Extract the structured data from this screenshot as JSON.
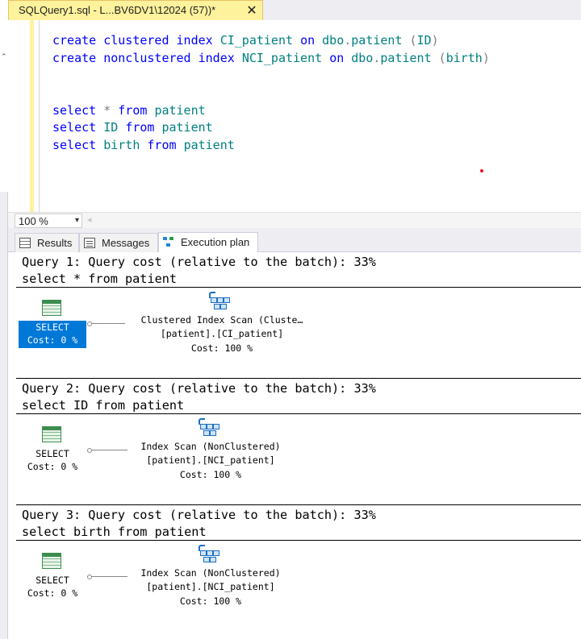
{
  "window": {
    "tab_title": "SQLQuery1.sql - L...BV6DV1\\12024 (57))*",
    "tab_close": "✕"
  },
  "editor": {
    "lines": [
      [
        {
          "t": "create",
          "c": "kw"
        },
        {
          "t": " ",
          "c": "txt"
        },
        {
          "t": "clustered",
          "c": "kw"
        },
        {
          "t": " ",
          "c": "txt"
        },
        {
          "t": "index",
          "c": "kw"
        },
        {
          "t": " ",
          "c": "txt"
        },
        {
          "t": "CI_patient",
          "c": "id"
        },
        {
          "t": " ",
          "c": "txt"
        },
        {
          "t": "on",
          "c": "kw"
        },
        {
          "t": " ",
          "c": "txt"
        },
        {
          "t": "dbo",
          "c": "id"
        },
        {
          "t": ".",
          "c": "op"
        },
        {
          "t": "patient",
          "c": "id"
        },
        {
          "t": " ",
          "c": "txt"
        },
        {
          "t": "(",
          "c": "op"
        },
        {
          "t": "ID",
          "c": "id"
        },
        {
          "t": ")",
          "c": "op"
        }
      ],
      [
        {
          "t": "create",
          "c": "kw"
        },
        {
          "t": " ",
          "c": "txt"
        },
        {
          "t": "nonclustered",
          "c": "kw"
        },
        {
          "t": " ",
          "c": "txt"
        },
        {
          "t": "index",
          "c": "kw"
        },
        {
          "t": " ",
          "c": "txt"
        },
        {
          "t": "NCI_patient",
          "c": "id"
        },
        {
          "t": " ",
          "c": "txt"
        },
        {
          "t": "on",
          "c": "kw"
        },
        {
          "t": " ",
          "c": "txt"
        },
        {
          "t": "dbo",
          "c": "id"
        },
        {
          "t": ".",
          "c": "op"
        },
        {
          "t": "patient",
          "c": "id"
        },
        {
          "t": " ",
          "c": "txt"
        },
        {
          "t": "(",
          "c": "op"
        },
        {
          "t": "birth",
          "c": "id"
        },
        {
          "t": ")",
          "c": "op"
        }
      ],
      [],
      [],
      [
        {
          "t": "select",
          "c": "kw"
        },
        {
          "t": " ",
          "c": "txt"
        },
        {
          "t": "*",
          "c": "op"
        },
        {
          "t": " ",
          "c": "txt"
        },
        {
          "t": "from",
          "c": "kw"
        },
        {
          "t": " ",
          "c": "txt"
        },
        {
          "t": "patient",
          "c": "id"
        }
      ],
      [
        {
          "t": "select",
          "c": "kw"
        },
        {
          "t": " ",
          "c": "txt"
        },
        {
          "t": "ID",
          "c": "id"
        },
        {
          "t": " ",
          "c": "txt"
        },
        {
          "t": "from",
          "c": "kw"
        },
        {
          "t": " ",
          "c": "txt"
        },
        {
          "t": "patient",
          "c": "id"
        }
      ],
      [
        {
          "t": "select",
          "c": "kw"
        },
        {
          "t": " ",
          "c": "txt"
        },
        {
          "t": "birth",
          "c": "id"
        },
        {
          "t": " ",
          "c": "txt"
        },
        {
          "t": "from",
          "c": "kw"
        },
        {
          "t": " ",
          "c": "txt"
        },
        {
          "t": "patient",
          "c": "id"
        }
      ]
    ]
  },
  "zoom": {
    "value": "100 %",
    "arrow": "▾",
    "scroll_left": "◂"
  },
  "result_tabs": [
    {
      "label": "Results",
      "icon": "grid-icon"
    },
    {
      "label": "Messages",
      "icon": "messages-icon"
    },
    {
      "label": "Execution plan",
      "icon": "execution-plan-icon",
      "active": true
    }
  ],
  "queries": [
    {
      "header": "Query 1: Query cost (relative to the batch): 33%",
      "sql": "select * from patient",
      "select_label": "SELECT",
      "select_cost": "Cost: 0 %",
      "selected": true,
      "op_line1": "Clustered Index Scan (Cluste…",
      "op_line2": "[patient].[CI_patient]",
      "op_cost": "Cost: 100 %"
    },
    {
      "header": "Query 2: Query cost (relative to the batch): 33%",
      "sql": "select ID from patient",
      "select_label": "SELECT",
      "select_cost": "Cost: 0 %",
      "selected": false,
      "op_line1": "Index Scan (NonClustered)",
      "op_line2": "[patient].[NCI_patient]",
      "op_cost": "Cost: 100 %"
    },
    {
      "header": "Query 3: Query cost (relative to the batch): 33%",
      "sql": "select birth from patient",
      "select_label": "SELECT",
      "select_cost": "Cost: 0 %",
      "selected": false,
      "op_line1": "Index Scan (NonClustered)",
      "op_line2": "[patient].[NCI_patient]",
      "op_cost": "Cost: 100 %"
    }
  ]
}
